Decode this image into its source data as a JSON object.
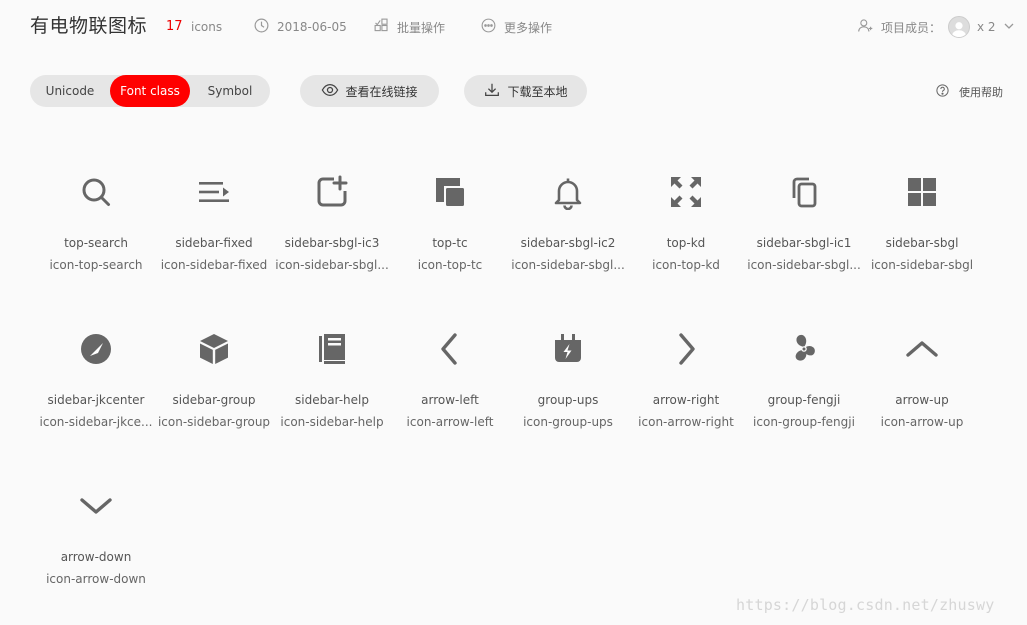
{
  "header": {
    "title": "有电物联图标",
    "count": "17",
    "count_unit": "icons",
    "date": "2018-06-05",
    "batch_label": "批量操作",
    "more_label": "更多操作",
    "members_label": "项目成员：",
    "members_count": "x 2",
    "icons": [
      "clock-icon",
      "batch-icon",
      "more-icon",
      "member-icon",
      "avatar-icon",
      "chevron-down-icon"
    ]
  },
  "toolbar": {
    "tabs": [
      {
        "label": "Unicode",
        "active": false
      },
      {
        "label": "Font class",
        "active": true
      },
      {
        "label": "Symbol",
        "active": false
      }
    ],
    "view_online_label": "查看在线链接",
    "download_label": "下载至本地",
    "help_label": "使用帮助",
    "accent": "#ff0000"
  },
  "icons": [
    {
      "name": "top-search",
      "class": "icon-top-search",
      "icon": "search-icon"
    },
    {
      "name": "sidebar-fixed",
      "class": "icon-sidebar-fixed",
      "icon": "menu-fixed-icon"
    },
    {
      "name": "sidebar-sbgl-ic3",
      "class": "icon-sidebar-sbgl...",
      "icon": "add-device-icon"
    },
    {
      "name": "top-tc",
      "class": "icon-top-tc",
      "icon": "overlay-icon"
    },
    {
      "name": "sidebar-sbgl-ic2",
      "class": "icon-sidebar-sbgl...",
      "icon": "bell-icon"
    },
    {
      "name": "top-kd",
      "class": "icon-top-kd",
      "icon": "expand-icon"
    },
    {
      "name": "sidebar-sbgl-ic1",
      "class": "icon-sidebar-sbgl...",
      "icon": "copy-icon"
    },
    {
      "name": "sidebar-sbgl",
      "class": "icon-sidebar-sbgl",
      "icon": "grid-icon"
    },
    {
      "name": "sidebar-jkcenter",
      "class": "icon-sidebar-jkce...",
      "icon": "gauge-icon"
    },
    {
      "name": "sidebar-group",
      "class": "icon-sidebar-group",
      "icon": "cube-icon"
    },
    {
      "name": "sidebar-help",
      "class": "icon-sidebar-help",
      "icon": "book-icon"
    },
    {
      "name": "arrow-left",
      "class": "icon-arrow-left",
      "icon": "arrow-left-icon"
    },
    {
      "name": "group-ups",
      "class": "icon-group-ups",
      "icon": "ups-icon"
    },
    {
      "name": "arrow-right",
      "class": "icon-arrow-right",
      "icon": "arrow-right-icon"
    },
    {
      "name": "group-fengji",
      "class": "icon-group-fengji",
      "icon": "fan-icon"
    },
    {
      "name": "arrow-up",
      "class": "icon-arrow-up",
      "icon": "arrow-up-icon"
    },
    {
      "name": "arrow-down",
      "class": "icon-arrow-down",
      "icon": "arrow-down-icon"
    }
  ],
  "watermark": "https://blog.csdn.net/zhuswy",
  "colors": {
    "icon": "#666666",
    "accent": "#ff0000",
    "background": "#fafafa"
  }
}
